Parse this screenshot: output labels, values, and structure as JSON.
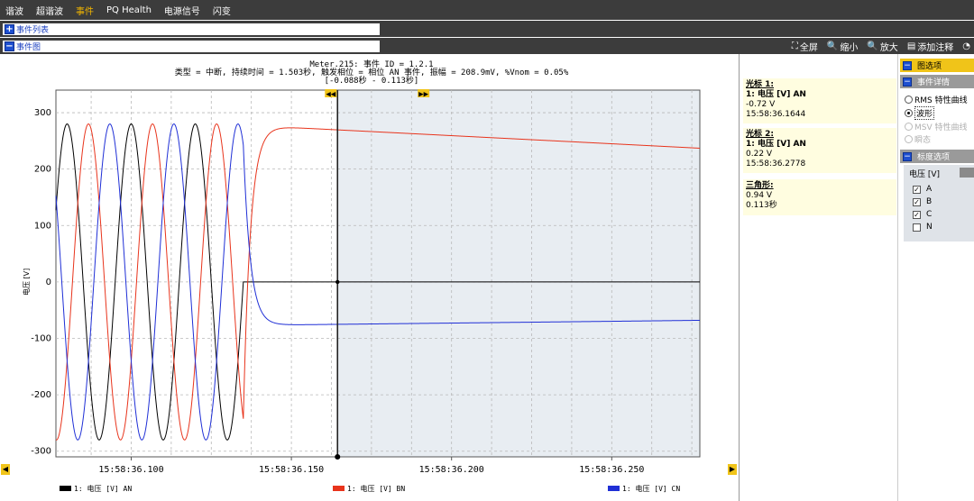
{
  "nav": {
    "items": [
      "谐波",
      "超谐波",
      "事件",
      "PQ Health",
      "电源信号",
      "闪变"
    ],
    "active_index": 2
  },
  "sections": {
    "event_list": "事件列表",
    "event_chart": "事件图"
  },
  "toolbar": {
    "fullscreen": "全屏",
    "zoom_out": "缩小",
    "zoom_in": "放大",
    "annotate": "添加注释"
  },
  "chart_header": {
    "line1": "Meter.215: 事件 ID = 1.2.1",
    "line2": "类型 = 中断, 持续时间 = 1.503秒, 触发相位 = 相位 AN 事件, 振幅 = 208.9mV, %Vnom = 0.05%",
    "line3": "[-0.088秒 - 0.113秒]"
  },
  "chart_data": {
    "type": "line",
    "ylabel": "电压 [V]",
    "xlabel": "",
    "ylim": [
      -310,
      340
    ],
    "yticks": [
      -300,
      -200,
      -100,
      0,
      100,
      200,
      300
    ],
    "xtick_labels": [
      "15:58:36.100",
      "15:58:36.150",
      "15:58:36.200",
      "15:58:36.250"
    ],
    "xtick_times_ms": [
      100,
      150,
      200,
      250
    ],
    "xlim_ms": [
      76.5,
      277.5
    ],
    "frequency_hz": 50,
    "amplitude": 280,
    "interruption_start_ms": 135,
    "cursor1_ms": 164.4,
    "cursor2_ms": 277.8,
    "series": [
      {
        "name": "1: 电压 [V] AN",
        "color": "#000000",
        "phase_deg": 0,
        "settle_value": 0
      },
      {
        "name": "1: 电压 [V] BN",
        "color": "#e8341c",
        "phase_deg": -120,
        "settle_value": 278,
        "end_value": 237
      },
      {
        "name": "1: 电压 [V] CN",
        "color": "#1f2fd6",
        "phase_deg": 120,
        "settle_value": -77,
        "end_value": -68
      }
    ]
  },
  "cursor1": {
    "title": "光标 1:",
    "channel": "1: 电压 [V] AN",
    "value": "-0.72 V",
    "time": "15:58:36.1644"
  },
  "cursor2": {
    "title": "光标 2:",
    "channel": "1: 电压 [V] AN",
    "value": "0.22 V",
    "time": "15:58:36.2778"
  },
  "delta": {
    "title": "三角形:",
    "value": "0.94 V",
    "time": "0.113秒"
  },
  "options": {
    "chart_options": "图选项",
    "event_details": "事件详情",
    "rms": "RMS 特性曲线",
    "waveform": "波形",
    "msv": "MSV 特性曲线",
    "transient": "瞬态",
    "scale_options": "标度选项",
    "scale_tab": "电压 [V]",
    "phases": [
      "A",
      "B",
      "C",
      "N"
    ],
    "phase_checked": [
      true,
      true,
      true,
      false
    ]
  },
  "colors": {
    "accent": "#f0c419",
    "dark_bar": "#3c3c3c",
    "plot_shade": "#e8edf2"
  }
}
